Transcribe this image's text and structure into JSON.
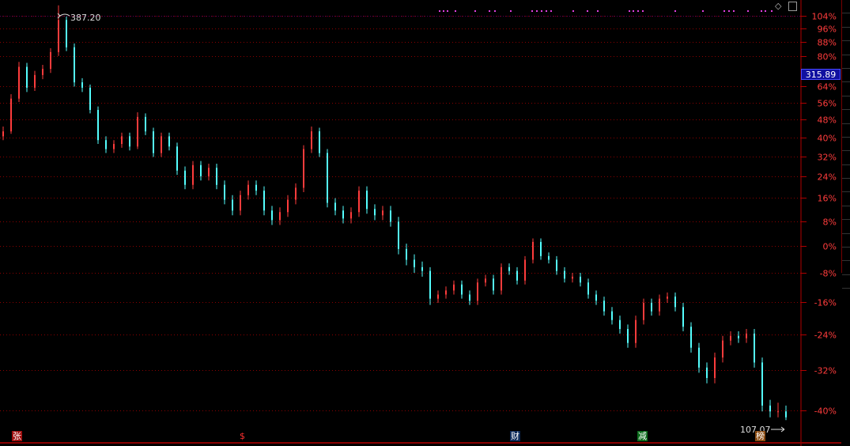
{
  "chart_data": {
    "type": "candlestick",
    "scale": "log",
    "base_price": 183.7,
    "y_ticks": [
      "104%",
      "96%",
      "88%",
      "80%",
      "64%",
      "56%",
      "48%",
      "40%",
      "32%",
      "24%",
      "16%",
      "8%",
      "0%",
      "-8%",
      "-16%",
      "-24%",
      "-32%",
      "-40%"
    ],
    "grid": true,
    "current_price": "315.89",
    "max_annotation": "387.20",
    "min_annotation": "107.07",
    "colors": {
      "up": "#ff3c3c",
      "down": "#54ffff",
      "grid": "#8a0000",
      "axis": "#b00000",
      "price_box": "#1010a0"
    },
    "candles": [
      [
        258,
        266,
        255,
        262
      ],
      [
        262,
        294,
        260,
        290
      ],
      [
        290,
        325,
        287,
        320
      ],
      [
        320,
        324,
        296,
        300
      ],
      [
        300,
        316,
        297,
        312
      ],
      [
        312,
        322,
        308,
        318
      ],
      [
        318,
        339,
        314,
        335
      ],
      [
        335,
        387.2,
        331,
        370
      ],
      [
        370,
        374,
        336,
        340
      ],
      [
        340,
        344,
        301,
        305
      ],
      [
        305,
        309,
        296,
        300
      ],
      [
        300,
        303,
        277,
        280
      ],
      [
        280,
        283,
        252,
        255
      ],
      [
        255,
        258,
        245,
        248
      ],
      [
        248,
        255,
        245,
        252
      ],
      [
        252,
        261,
        249,
        258
      ],
      [
        258,
        261,
        247,
        250
      ],
      [
        250,
        278,
        248,
        274
      ],
      [
        274,
        277,
        259,
        262
      ],
      [
        262,
        265,
        242,
        245
      ],
      [
        245,
        261,
        242,
        258
      ],
      [
        258,
        261,
        247,
        250
      ],
      [
        250,
        253,
        229,
        232
      ],
      [
        232,
        235,
        219,
        222
      ],
      [
        222,
        239,
        219,
        236
      ],
      [
        236,
        239,
        225,
        228
      ],
      [
        228,
        237,
        225,
        234
      ],
      [
        234,
        237,
        219,
        222
      ],
      [
        222,
        225,
        209,
        212
      ],
      [
        212,
        215,
        202,
        205
      ],
      [
        205,
        218,
        202,
        215
      ],
      [
        215,
        225,
        212,
        222
      ],
      [
        222,
        225,
        215,
        218
      ],
      [
        218,
        221,
        202,
        205
      ],
      [
        205,
        208,
        196,
        199
      ],
      [
        199,
        207,
        196,
        204
      ],
      [
        204,
        215,
        201,
        212
      ],
      [
        212,
        223,
        209,
        220
      ],
      [
        220,
        251,
        217,
        248
      ],
      [
        248,
        266,
        245,
        262
      ],
      [
        262,
        265,
        242,
        245
      ],
      [
        245,
        248,
        207,
        210
      ],
      [
        210,
        213,
        202,
        205
      ],
      [
        205,
        208,
        197,
        200
      ],
      [
        200,
        207,
        197,
        204
      ],
      [
        204,
        221,
        201,
        218
      ],
      [
        218,
        221,
        203,
        206
      ],
      [
        206,
        209,
        199,
        202
      ],
      [
        202,
        208,
        199,
        205
      ],
      [
        205,
        208,
        195,
        198
      ],
      [
        198,
        201,
        179,
        182
      ],
      [
        182,
        185,
        173,
        176
      ],
      [
        176,
        179,
        169,
        172
      ],
      [
        172,
        175,
        167,
        170
      ],
      [
        170,
        172,
        153,
        156
      ],
      [
        156,
        160,
        154,
        158
      ],
      [
        158,
        162,
        156,
        160
      ],
      [
        160,
        165,
        158,
        163
      ],
      [
        163,
        165,
        156,
        158
      ],
      [
        158,
        160,
        153,
        155
      ],
      [
        155,
        166,
        153,
        164
      ],
      [
        164,
        168,
        162,
        166
      ],
      [
        166,
        168,
        158,
        160
      ],
      [
        160,
        174,
        158,
        172
      ],
      [
        172,
        174,
        168,
        170
      ],
      [
        170,
        172,
        163,
        165
      ],
      [
        165,
        178,
        163,
        176
      ],
      [
        176,
        188,
        174,
        186
      ],
      [
        186,
        188,
        176,
        178
      ],
      [
        178,
        180,
        174,
        176
      ],
      [
        176,
        178,
        168,
        170
      ],
      [
        170,
        172,
        164,
        166
      ],
      [
        166,
        169,
        164,
        167
      ],
      [
        167,
        169,
        162,
        164
      ],
      [
        164,
        166,
        156,
        158
      ],
      [
        158,
        160,
        153,
        155
      ],
      [
        155,
        157,
        148,
        150
      ],
      [
        150,
        152,
        144,
        146
      ],
      [
        146,
        148,
        140,
        142
      ],
      [
        142,
        144,
        134,
        136
      ],
      [
        136,
        148,
        134,
        146
      ],
      [
        146,
        156,
        144,
        154
      ],
      [
        154,
        156,
        148,
        150
      ],
      [
        150,
        158,
        148,
        156
      ],
      [
        156,
        159,
        154,
        157
      ],
      [
        157,
        159,
        150,
        152
      ],
      [
        152,
        154,
        141,
        143
      ],
      [
        143,
        145,
        132,
        134
      ],
      [
        134,
        136,
        124,
        126
      ],
      [
        126,
        128,
        120,
        122
      ],
      [
        122,
        132,
        120,
        130
      ],
      [
        130,
        139,
        128,
        137
      ],
      [
        137,
        141,
        135,
        139
      ],
      [
        139,
        141,
        136,
        138
      ],
      [
        138,
        142,
        136,
        140
      ],
      [
        140,
        142,
        126,
        128
      ],
      [
        128,
        130,
        110,
        112
      ],
      [
        112,
        114,
        108,
        110
      ],
      [
        110,
        113,
        108,
        110
      ],
      [
        110,
        112,
        107.07,
        108
      ]
    ]
  },
  "markers": [
    {
      "label": "张",
      "bg": "#a01010",
      "color": "#fff"
    },
    {
      "label": "$",
      "bg": "transparent",
      "color": "#ff3030"
    },
    {
      "label": "财",
      "bg": "#0a2a5a",
      "color": "#fff"
    },
    {
      "label": "减",
      "bg": "#0a6a1a",
      "color": "#fff"
    },
    {
      "label": "榜",
      "bg": "#8a4a10",
      "color": "#fff"
    }
  ],
  "toolbar": {
    "diamond_icon": "diamond-icon",
    "panel_icon": "panel-toggle-icon"
  }
}
